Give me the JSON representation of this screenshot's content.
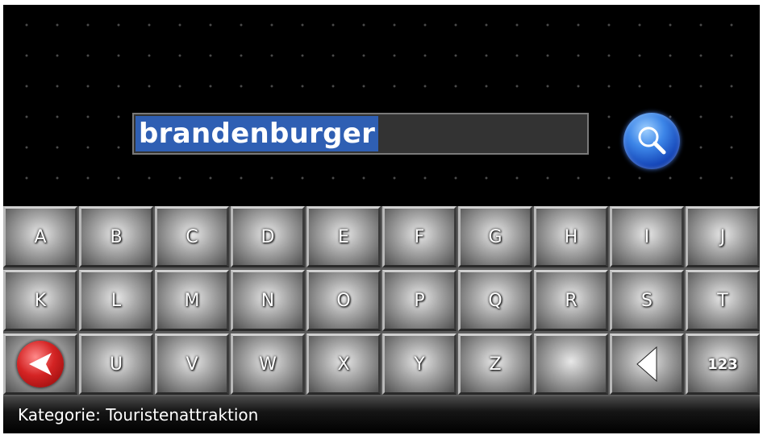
{
  "search": {
    "value": "brandenburger"
  },
  "keyboard": {
    "row1": [
      "A",
      "B",
      "C",
      "D",
      "E",
      "F",
      "G",
      "H",
      "I",
      "J"
    ],
    "row2": [
      "K",
      "L",
      "M",
      "N",
      "O",
      "P",
      "Q",
      "R",
      "S",
      "T"
    ],
    "row3": [
      "U",
      "V",
      "W",
      "X",
      "Y",
      "Z"
    ],
    "numbers_label": "123"
  },
  "status": {
    "text": "Kategorie: Touristenattraktion"
  },
  "icons": {
    "search": "magnifier-icon",
    "back": "back-arrow-icon",
    "delete": "delete-left-arrow-icon"
  },
  "colors": {
    "background": "#000000",
    "selection": "#2f5fb3",
    "search_button": "#3d86e8",
    "back_button": "#d42424"
  }
}
